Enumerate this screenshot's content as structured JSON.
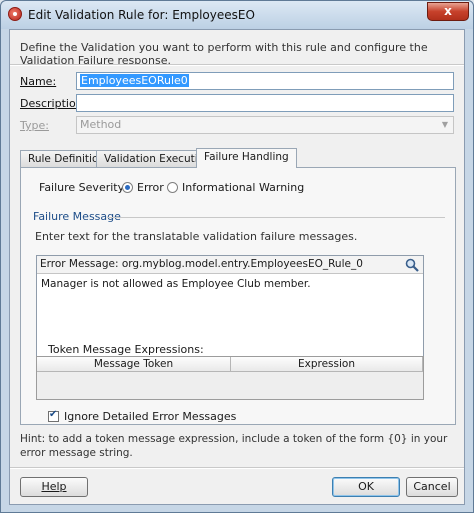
{
  "window": {
    "title": "Edit Validation Rule for: EmployeesEO",
    "close_glyph": "x"
  },
  "description": "Define the Validation you want to perform with this rule and configure the Validation Failure response.",
  "form": {
    "name_label": "Name:",
    "name_value": "EmployeesEORule0",
    "description_label": "Description",
    "description_value": "",
    "type_label": "Type:",
    "type_value": "Method"
  },
  "tabs": [
    {
      "label": "Rule Definition"
    },
    {
      "label": "Validation Execution"
    },
    {
      "label": "Failure Handling"
    }
  ],
  "failure_handling": {
    "severity_label": "Failure Severity",
    "severity_options": [
      {
        "label": "Error",
        "checked": true
      },
      {
        "label": "Informational Warning",
        "checked": false
      }
    ],
    "group_label": "Failure Message",
    "instructions": "Enter text for the translatable validation failure messages.",
    "error_message_label": "Error Message: org.myblog.model.entry.EmployeesEO_Rule_0",
    "error_message_text": "Manager is not allowed as Employee Club member.",
    "token_label": "Token Message Expressions:",
    "token_columns": [
      "Message Token",
      "Expression"
    ],
    "ignore_label": "Ignore Detailed Error Messages",
    "ignore_checked": true
  },
  "hint": "Hint: to add a token message expression, include a token of the form {0} in your error message string.",
  "buttons": {
    "help": "Help",
    "ok": "OK",
    "cancel": "Cancel"
  },
  "colors": {
    "accent": "#3399ff",
    "group_label": "#1c4c88"
  }
}
